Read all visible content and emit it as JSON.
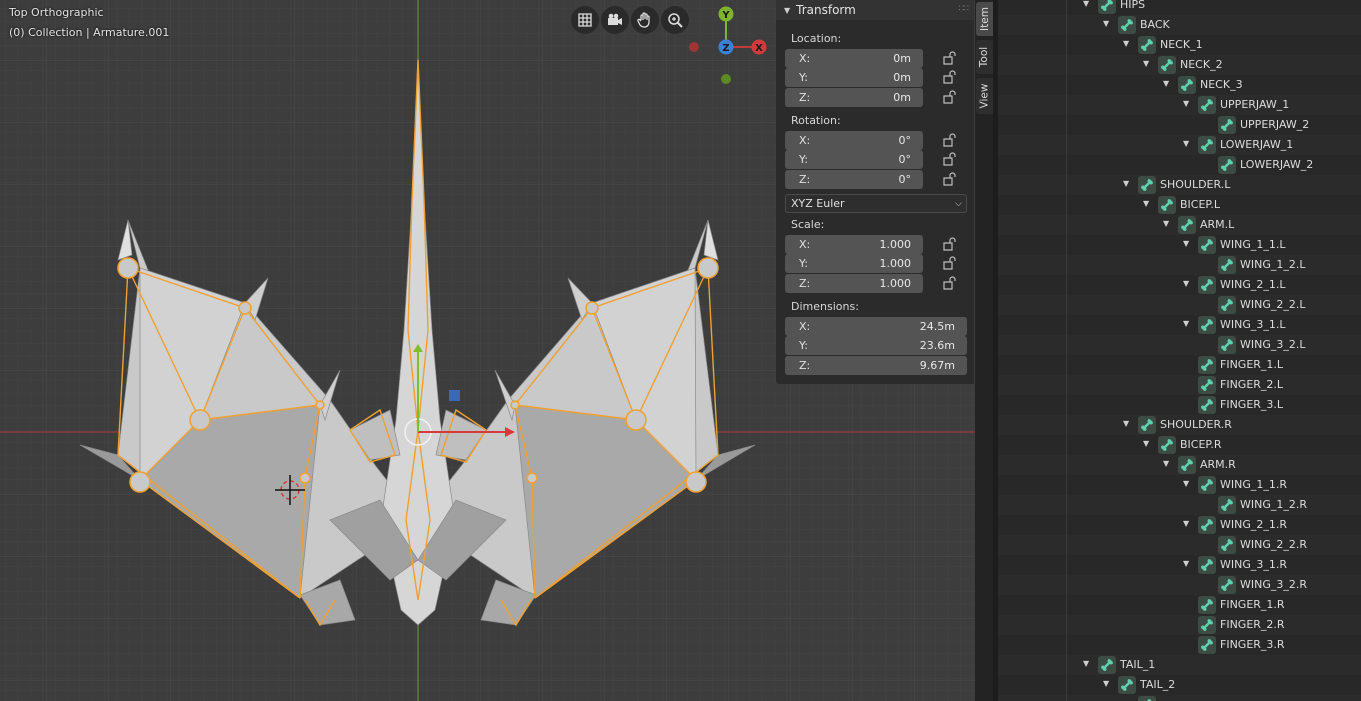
{
  "viewport": {
    "view_name": "Top Orthographic",
    "context": "(0) Collection | Armature.001",
    "nav_buttons": [
      "grid-icon",
      "camera-icon",
      "hand-icon",
      "zoom-icon"
    ],
    "gizmo": {
      "y": "Y",
      "z": "Z",
      "x": "X"
    }
  },
  "transform_panel": {
    "title": "Transform",
    "location": {
      "label": "Location:",
      "x": "0m",
      "y": "0m",
      "z": "0m"
    },
    "rotation": {
      "label": "Rotation:",
      "x": "0°",
      "y": "0°",
      "z": "0°"
    },
    "rotation_mode": "XYZ Euler",
    "scale": {
      "label": "Scale:",
      "x": "1.000",
      "y": "1.000",
      "z": "1.000"
    },
    "dimensions": {
      "label": "Dimensions:",
      "x": "24.5m",
      "y": "23.6m",
      "z": "9.67m"
    },
    "axis_labels": {
      "x": "X:",
      "y": "Y:",
      "z": "Z:"
    }
  },
  "tabs": [
    "Item",
    "Tool",
    "View"
  ],
  "outliner": {
    "items": [
      {
        "name": "HIPS",
        "level": 0,
        "expanded": true
      },
      {
        "name": "BACK",
        "level": 1,
        "expanded": true
      },
      {
        "name": "NECK_1",
        "level": 2,
        "expanded": true
      },
      {
        "name": "NECK_2",
        "level": 3,
        "expanded": true
      },
      {
        "name": "NECK_3",
        "level": 4,
        "expanded": true
      },
      {
        "name": "UPPERJAW_1",
        "level": 5,
        "expanded": true
      },
      {
        "name": "UPPERJAW_2",
        "level": 6,
        "expanded": false
      },
      {
        "name": "LOWERJAW_1",
        "level": 5,
        "expanded": true
      },
      {
        "name": "LOWERJAW_2",
        "level": 6,
        "expanded": false
      },
      {
        "name": "SHOULDER.L",
        "level": 2,
        "expanded": true
      },
      {
        "name": "BICEP.L",
        "level": 3,
        "expanded": true
      },
      {
        "name": "ARM.L",
        "level": 4,
        "expanded": true
      },
      {
        "name": "WING_1_1.L",
        "level": 5,
        "expanded": true
      },
      {
        "name": "WING_1_2.L",
        "level": 6,
        "expanded": false
      },
      {
        "name": "WING_2_1.L",
        "level": 5,
        "expanded": true
      },
      {
        "name": "WING_2_2.L",
        "level": 6,
        "expanded": false
      },
      {
        "name": "WING_3_1.L",
        "level": 5,
        "expanded": true
      },
      {
        "name": "WING_3_2.L",
        "level": 6,
        "expanded": false
      },
      {
        "name": "FINGER_1.L",
        "level": 5,
        "expanded": false
      },
      {
        "name": "FINGER_2.L",
        "level": 5,
        "expanded": false
      },
      {
        "name": "FINGER_3.L",
        "level": 5,
        "expanded": false
      },
      {
        "name": "SHOULDER.R",
        "level": 2,
        "expanded": true
      },
      {
        "name": "BICEP.R",
        "level": 3,
        "expanded": true
      },
      {
        "name": "ARM.R",
        "level": 4,
        "expanded": true
      },
      {
        "name": "WING_1_1.R",
        "level": 5,
        "expanded": true
      },
      {
        "name": "WING_1_2.R",
        "level": 6,
        "expanded": false
      },
      {
        "name": "WING_2_1.R",
        "level": 5,
        "expanded": true
      },
      {
        "name": "WING_2_2.R",
        "level": 6,
        "expanded": false
      },
      {
        "name": "WING_3_1.R",
        "level": 5,
        "expanded": true
      },
      {
        "name": "WING_3_2.R",
        "level": 6,
        "expanded": false
      },
      {
        "name": "FINGER_1.R",
        "level": 5,
        "expanded": false
      },
      {
        "name": "FINGER_2.R",
        "level": 5,
        "expanded": false
      },
      {
        "name": "FINGER_3.R",
        "level": 5,
        "expanded": false
      },
      {
        "name": "TAIL_1",
        "level": 0,
        "expanded": true
      },
      {
        "name": "TAIL_2",
        "level": 1,
        "expanded": true
      },
      {
        "name": "",
        "level": 2,
        "expanded": false
      }
    ]
  },
  "colors": {
    "viewport_bg": "#3d3d3d",
    "axis_x": "#c23a3a",
    "axis_y": "#6fa32a",
    "axis_z": "#3a82d6",
    "bone_outline": "#f0a030",
    "mesh": "#bdbdbd",
    "bone_icon": "#4fc3a1"
  }
}
